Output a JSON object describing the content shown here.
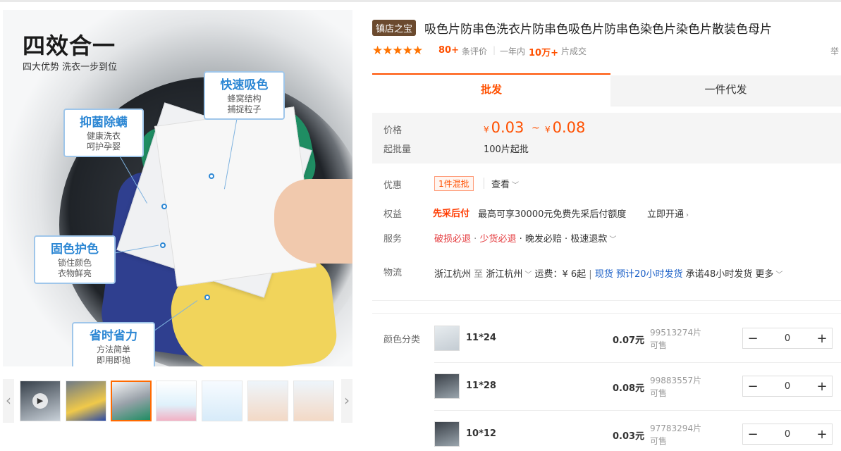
{
  "gallery": {
    "promo_title": "四效合一",
    "promo_sub": "四大优势 洗衣一步到位",
    "callouts": [
      {
        "title": "快速吸色",
        "body": "蜂窝结构\n捕捉粒子"
      },
      {
        "title": "抑菌除螨",
        "body": "健康洗衣\n呵护孕婴"
      },
      {
        "title": "固色护色",
        "body": "锁住颜色\n衣物鲜亮"
      },
      {
        "title": "省时省力",
        "body": "方法简单\n即用即抛"
      }
    ],
    "thumb_count": 7,
    "active_thumb": 2,
    "prev_icon": "chevron-left-icon",
    "next_icon": "chevron-right-icon"
  },
  "product": {
    "shop_badge": "镇店之宝",
    "title": "吸色片防串色洗衣片防串色吸色片防串色染色片染色片散装色母片",
    "stars": "★★★★★",
    "rating_count": "80+",
    "rating_label": "条评价",
    "year_label": "一年内",
    "year_count": "10万+",
    "year_suffix": "片成交",
    "cut_text": "举"
  },
  "tabs": {
    "wholesale": "批发",
    "dropship": "一件代发"
  },
  "pricing": {
    "price_label": "价格",
    "currency": "¥",
    "price_low": "0.03",
    "price_tilde": "~",
    "price_high": "0.08",
    "moq_label": "起批量",
    "moq_value": "100片起批"
  },
  "info": {
    "discount_label": "优惠",
    "discount_tag": "1件混批",
    "discount_view": "查看",
    "benefit_label": "权益",
    "benefit_tag": "先采后付",
    "benefit_text": "最高可享30000元免费先采后付额度",
    "benefit_action": "立即开通",
    "service_label": "服务",
    "services": [
      "破损必退",
      "少货必退",
      "晚发必赔",
      "极速退款"
    ],
    "logistics_label": "物流",
    "from": "浙江杭州",
    "to_word": "至",
    "to": "浙江杭州",
    "shipping_fee": "运费：¥ 6起",
    "stock_status": "现货",
    "ship_promise": "预计20小时发货",
    "commit": "承诺48小时发货",
    "more": "更多"
  },
  "sku": {
    "label": "颜色分类",
    "items": [
      {
        "name": "11*24",
        "price": "0.07元",
        "stock": "99513274片",
        "avail": "可售",
        "qty": "0"
      },
      {
        "name": "11*28",
        "price": "0.08元",
        "stock": "99883557片",
        "avail": "可售",
        "qty": "0"
      },
      {
        "name": "10*12",
        "price": "0.03元",
        "stock": "97783294片",
        "avail": "可售",
        "qty": "0"
      }
    ],
    "minus": "−",
    "plus": "+"
  }
}
